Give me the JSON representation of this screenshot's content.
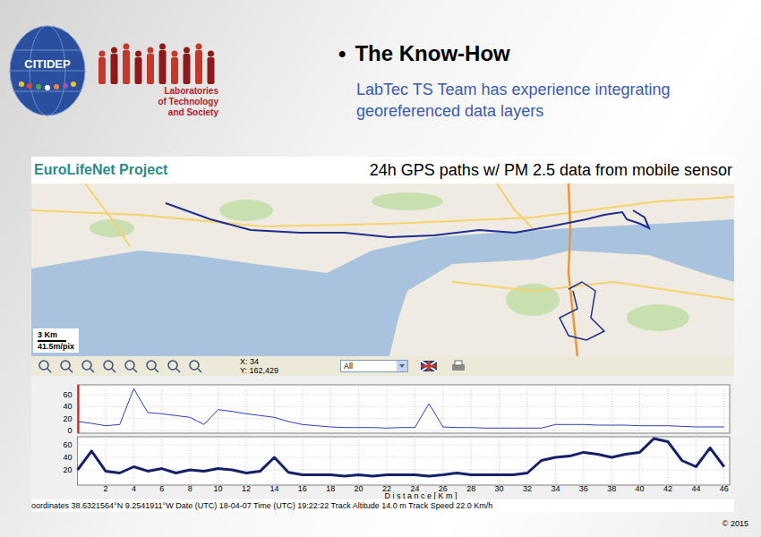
{
  "logos": {
    "citidep": "CITIDEP",
    "lab": [
      "Laboratories",
      "of Technology",
      "and Society"
    ]
  },
  "title": {
    "bullet": "•",
    "text": "The Know-How"
  },
  "subtitle": "LabTec TS Team has experience integrating georeferenced data layers",
  "map": {
    "project": "EuroLifeNet Project",
    "caption": "24h GPS paths w/ PM 2.5 data from mobile sensor",
    "scale": {
      "distance": "3 Km",
      "resolution": "41.5m/pix"
    }
  },
  "toolbar": {
    "x": "X: 34",
    "y": "Y: 162,429",
    "filter": "All"
  },
  "chart": {
    "axis_title": "D i s t a n c e   [ K m ]",
    "x_ticks": [
      "2",
      "4",
      "6",
      "8",
      "10",
      "12",
      "14",
      "16",
      "18",
      "20",
      "22",
      "24",
      "26",
      "28",
      "30",
      "32",
      "34",
      "36",
      "38",
      "40",
      "42",
      "44",
      "46"
    ],
    "panels": [
      {
        "y_ticks": [
          "0",
          "20",
          "40",
          "60"
        ],
        "color": "#2b3fb5",
        "values": [
          15,
          12,
          8,
          10,
          70,
          30,
          28,
          25,
          22,
          10,
          35,
          32,
          28,
          25,
          22,
          15,
          10,
          8,
          6,
          5,
          5,
          5,
          4,
          5,
          5,
          45,
          6,
          5,
          5,
          4,
          4,
          4,
          4,
          4,
          10,
          10,
          10,
          9,
          9,
          9,
          8,
          8,
          8,
          7,
          6,
          6,
          6
        ]
      },
      {
        "y_ticks": [
          "20",
          "40",
          "60"
        ],
        "color": "#15206b",
        "values": [
          20,
          50,
          18,
          15,
          25,
          18,
          22,
          15,
          20,
          18,
          22,
          20,
          15,
          18,
          40,
          16,
          12,
          12,
          12,
          10,
          12,
          10,
          12,
          12,
          12,
          10,
          12,
          15,
          12,
          12,
          12,
          12,
          15,
          35,
          40,
          42,
          48,
          45,
          40,
          45,
          48,
          70,
          65,
          35,
          25,
          55,
          25
        ]
      }
    ]
  },
  "status_bar": "oordinates 38.6321564°N 9.2541911°W Date (UTC) 18-04-07 Time (UTC) 19:22:22 Track Altitude 14.0 m Track Speed 22.0 Km/h",
  "footer": "© 2015"
}
